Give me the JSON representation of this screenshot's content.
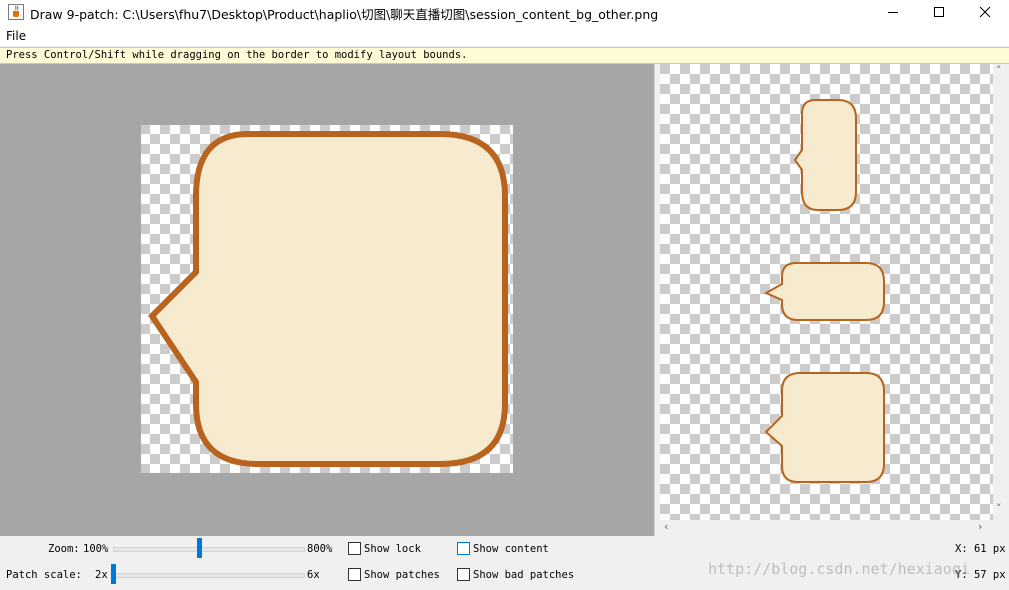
{
  "window": {
    "title": "Draw 9-patch: C:\\Users\\fhu7\\Desktop\\Product\\haplio\\切图\\聊天直播切图\\session_content_bg_other.png",
    "app_icon": "java-cup-icon",
    "controls": [
      "minimize-icon",
      "maximize-icon",
      "close-icon"
    ]
  },
  "menu": {
    "file": "File"
  },
  "hint": "Press Control/Shift while dragging on the border to modify layout bounds.",
  "colors": {
    "bubble_fill": "#f7ebcf",
    "bubble_border": "#b8641e",
    "editor_bg": "#a6a6a6",
    "hint_bg": "#fffbd6",
    "accent": "#0078d7"
  },
  "controls": {
    "zoom_label": "Zoom:",
    "zoom_min": "100%",
    "zoom_max": "800%",
    "zoom_value_fraction": 0.45,
    "patch_label": "Patch scale:",
    "patch_min": "2x",
    "patch_max": "6x",
    "patch_value_fraction": 0.0,
    "checkboxes": [
      {
        "label": "Show lock",
        "checked": false
      },
      {
        "label": "Show content",
        "checked": false
      },
      {
        "label": "Show patches",
        "checked": false
      },
      {
        "label": "Show bad patches",
        "checked": false
      }
    ],
    "coord_x": "X: 61 px",
    "coord_y": "Y: 57 px"
  },
  "watermark": "http://blog.csdn.net/hexiaoqi"
}
